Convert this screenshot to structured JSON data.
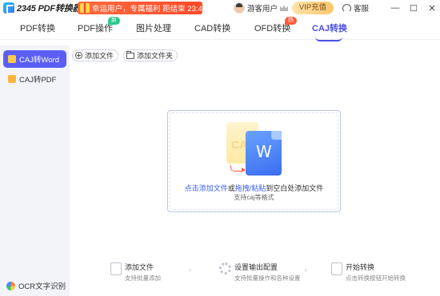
{
  "app": {
    "title": "2345 PDF转换器"
  },
  "promo": {
    "text": "幸运用户，专属福利 距结束 23:48:18"
  },
  "user": {
    "name": "游客用户"
  },
  "vip_button": "VIP充值",
  "service": "客服",
  "window_controls": {
    "minimize": "—",
    "maximize": "☐",
    "close": "✕"
  },
  "nav": {
    "tabs": [
      {
        "label": "PDF转换",
        "badge": ""
      },
      {
        "label": "PDF操作",
        "badge": "新"
      },
      {
        "label": "图片处理",
        "badge": ""
      },
      {
        "label": "CAD转换",
        "badge": ""
      },
      {
        "label": "OFD转换",
        "badge": "热"
      },
      {
        "label": "CAJ转换",
        "badge": ""
      }
    ],
    "active": "CAJ转换"
  },
  "sidebar": {
    "items": [
      {
        "label": "CAJ转Word",
        "active": true
      },
      {
        "label": "CAJ转PDF",
        "active": false
      }
    ],
    "ocr": "OCR文字识别"
  },
  "toolbar": {
    "add_file": "添加文件",
    "add_folder": "添加文件夹"
  },
  "dropzone": {
    "caj_label": "CAJ",
    "word_label": "W",
    "text_parts": [
      "点击添加文件",
      "或",
      "拖拽/粘贴",
      "到空白处添加文件"
    ],
    "subtext": "支持caj等格式"
  },
  "steps": [
    {
      "title": "添加文件",
      "desc": "支持批量添加"
    },
    {
      "title": "设置输出配置",
      "desc": "支持批量操作和各种设置"
    },
    {
      "title": "开始转换",
      "desc": "点击转换按钮开始转换"
    }
  ],
  "colors": {
    "accent": "#4b50e6",
    "sidebar_active": "#5b5ef5",
    "promo": "#ff5b3a",
    "new_badge": "#29c98a"
  }
}
